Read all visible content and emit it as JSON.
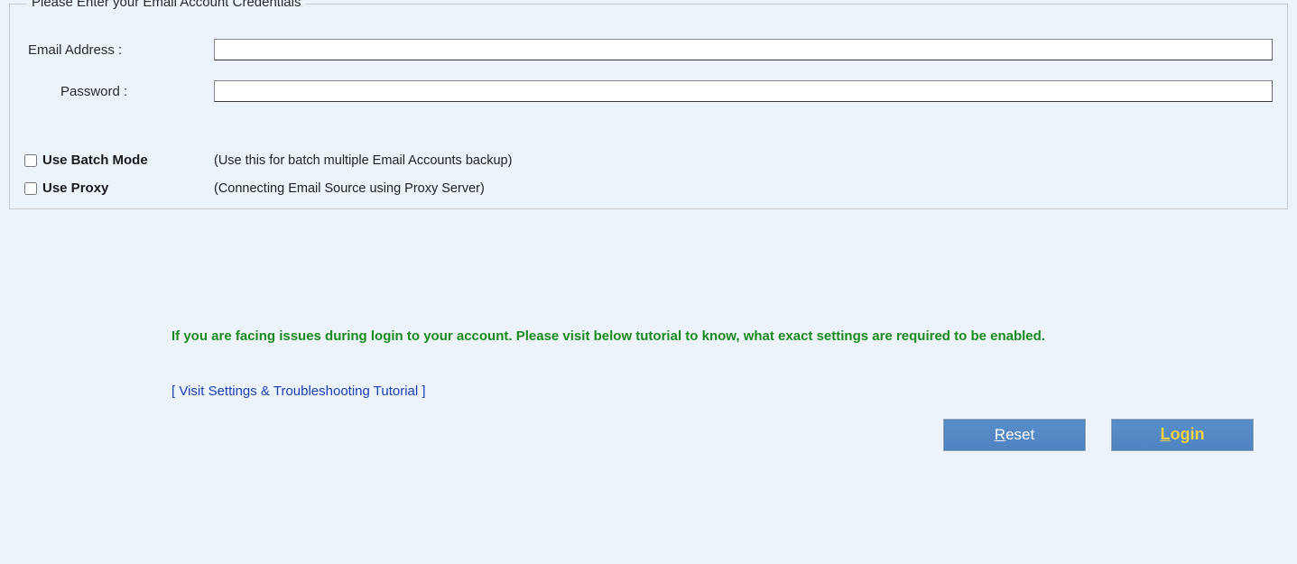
{
  "fieldset": {
    "legend": "Please Enter your Email Account Credentials",
    "email_label": "Email Address :",
    "email_value": "",
    "password_label": "Password :",
    "password_value": "",
    "batch_mode_label": "Use Batch Mode",
    "batch_mode_desc": "(Use this for batch multiple Email Accounts backup)",
    "use_proxy_label": "Use Proxy",
    "use_proxy_desc": "(Connecting Email Source using Proxy Server)"
  },
  "help": {
    "message": "If you are facing issues during login to your account. Please visit below tutorial to know, what exact settings are required to be enabled.",
    "tutorial_link": "[ Visit Settings & Troubleshooting Tutorial ]"
  },
  "buttons": {
    "reset": "Reset",
    "login": "Login"
  }
}
